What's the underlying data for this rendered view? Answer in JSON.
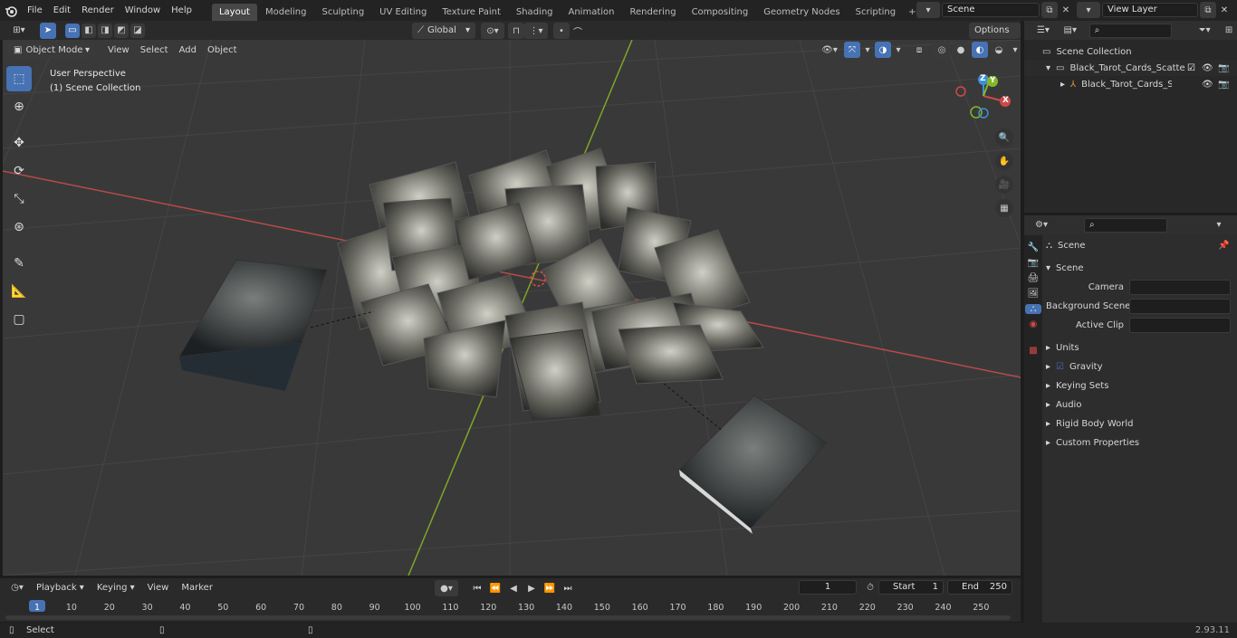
{
  "topbar": {
    "menus": [
      "File",
      "Edit",
      "Render",
      "Window",
      "Help"
    ],
    "workspaces": [
      "Layout",
      "Modeling",
      "Sculpting",
      "UV Editing",
      "Texture Paint",
      "Shading",
      "Animation",
      "Rendering",
      "Compositing",
      "Geometry Nodes",
      "Scripting"
    ],
    "add_tab": "+",
    "scene_name": "Scene",
    "view_layer": "View Layer"
  },
  "viewport_header": {
    "mode": "Object Mode",
    "menus": [
      "View",
      "Select",
      "Add",
      "Object"
    ],
    "transform": "Global",
    "options": "Options"
  },
  "viewport_overlay": {
    "perspective": "User Perspective",
    "collection": "(1) Scene Collection"
  },
  "gizmo": {
    "z": "Z",
    "y": "Y",
    "x": "X"
  },
  "outliner": {
    "root": "Scene Collection",
    "items": [
      "Black_Tarot_Cards_Scattered_",
      "Black_Tarot_Cards_Scatte"
    ]
  },
  "properties": {
    "context": "Scene",
    "section": "Scene",
    "fields": [
      "Camera",
      "Background Scene",
      "Active Clip"
    ],
    "panels": [
      "Units",
      "Gravity",
      "Keying Sets",
      "Audio",
      "Rigid Body World",
      "Custom Properties"
    ]
  },
  "timeline": {
    "menus": [
      "Playback",
      "Keying",
      "View",
      "Marker"
    ],
    "current_frame": "1",
    "start_label": "Start",
    "start": "1",
    "end_label": "End",
    "end": "250",
    "ticks": [
      "1",
      "10",
      "20",
      "30",
      "40",
      "50",
      "60",
      "70",
      "80",
      "90",
      "100",
      "110",
      "120",
      "130",
      "140",
      "150",
      "160",
      "170",
      "180",
      "190",
      "200",
      "210",
      "220",
      "230",
      "240",
      "250"
    ]
  },
  "statusbar": {
    "left": "Select",
    "version": "2.93.11"
  },
  "colors": {
    "accent": "#4772b3",
    "x_axis": "#d04848",
    "y_axis": "#85b828",
    "z_axis": "#3d8fd6",
    "orange": "#e8923a"
  }
}
